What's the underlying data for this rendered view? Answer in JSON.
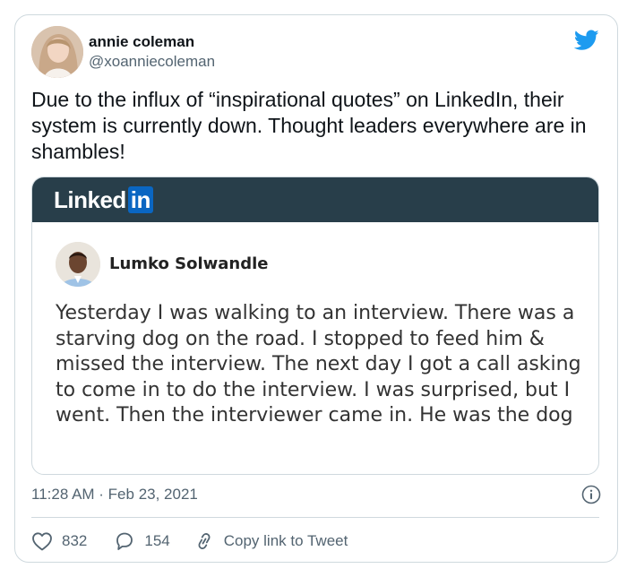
{
  "tweet": {
    "author_name": "annie coleman",
    "author_handle": "@xoanniecoleman",
    "text": "Due to the influx of “inspirational quotes” on LinkedIn, their system is currently down. Thought leaders everywhere are in shambles!",
    "timestamp": "11:28 AM · Feb 23, 2021",
    "brand_color": "#1d9bf0"
  },
  "embed": {
    "logo_text": "Linked",
    "logo_in": "in",
    "header_color": "#283e4a",
    "poster_name": "Lumko Solwandle",
    "post_text": "Yesterday I was walking to an interview. There was a starving dog on the road. I stopped to feed him & missed the interview. The next day I got a call asking to come in to do the interview. I was surprised, but I went. Then the interviewer came in. He was the dog"
  },
  "actions": {
    "likes": "832",
    "replies": "154",
    "copy_link_label": "Copy link to Tweet"
  },
  "icons": {
    "brand": "twitter-bird-icon",
    "info": "info-icon",
    "like": "heart-icon",
    "reply": "reply-icon",
    "copy": "link-icon"
  }
}
